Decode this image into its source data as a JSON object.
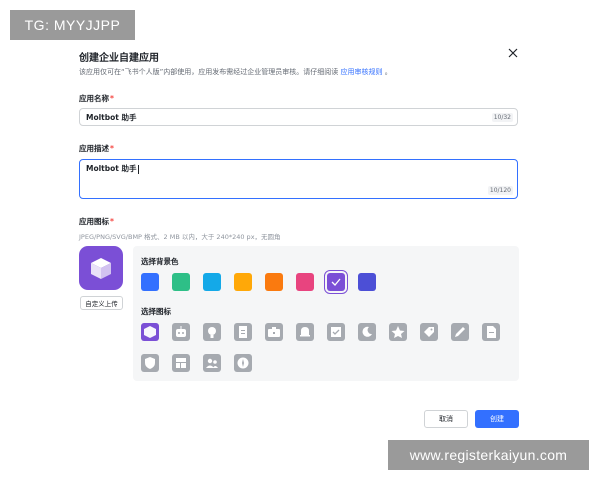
{
  "watermarks": {
    "top_left": "TG: MYYJJPP",
    "bottom_right": "www.registerkaiyun.com"
  },
  "dialog": {
    "title": "创建企业自建应用",
    "description": "该应用仅可在“飞书个人版”内部使用，应用发布需经过企业管理员审核。请仔细阅读",
    "description_link": "应用审核规则",
    "description_end": "。"
  },
  "form": {
    "name": {
      "label": "应用名称",
      "required_mark": "*",
      "value": "Moltbot 助手",
      "counter": "10/32"
    },
    "description": {
      "label": "应用描述",
      "required_mark": "*",
      "value": "Moltbot 助手",
      "counter": "10/120"
    },
    "icon": {
      "label": "应用图标",
      "required_mark": "*",
      "hint": "JPEG/PNG/SVG/BMP 格式、2 MB 以内，大于 240*240 px，无圆角",
      "upload_label": "自定义上传",
      "preview_color": "#7b4fd6"
    }
  },
  "background_picker": {
    "title": "选择背景色",
    "colors": [
      "#3370ff",
      "#2ebf87",
      "#14a9e8",
      "#ffa808",
      "#fa7a0f",
      "#e8447f",
      "#7b4fd6",
      "#4c4fd6"
    ],
    "selected_index": 6
  },
  "icon_picker": {
    "title": "选择图标",
    "icons": [
      "cube-icon",
      "robot-icon",
      "lightbulb-icon",
      "document-icon",
      "briefcase-icon",
      "bell-icon",
      "checklist-icon",
      "moon-icon",
      "star-icon",
      "tag-icon",
      "pen-icon",
      "file-icon",
      "shield-icon",
      "layout-icon",
      "users-icon",
      "compass-icon"
    ],
    "selected_index": 0
  },
  "footer": {
    "cancel_label": "取消",
    "create_label": "创建"
  }
}
